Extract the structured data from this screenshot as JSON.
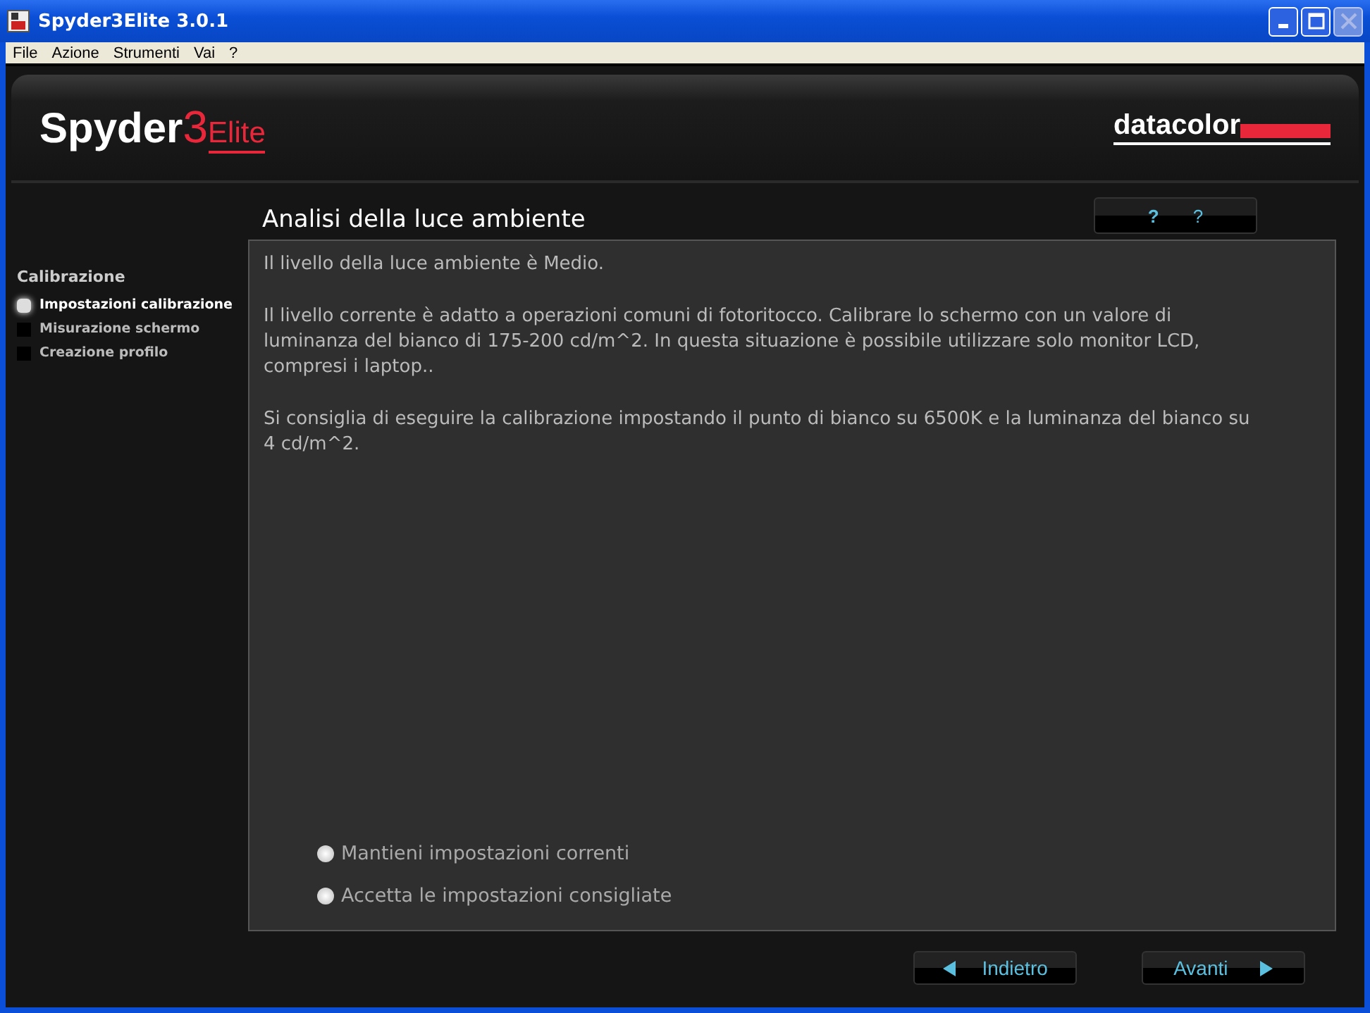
{
  "window": {
    "title": "Spyder3Elite 3.0.1"
  },
  "menu": [
    "File",
    "Azione",
    "Strumenti",
    "Vai",
    "?"
  ],
  "logo": {
    "brand": "Spyder",
    "number": "3",
    "edition": "Elite"
  },
  "vendor": "datacolor",
  "help": [
    "?",
    "?"
  ],
  "sidebar": {
    "heading": "Calibrazione",
    "steps": [
      {
        "label": "Impostazioni calibrazione",
        "selected": true
      },
      {
        "label": "Misurazione schermo",
        "selected": false
      },
      {
        "label": "Creazione profilo",
        "selected": false
      }
    ]
  },
  "page_title": "Analisi della luce ambiente",
  "paragraphs": [
    "Il livello della luce ambiente è Medio.",
    "Il livello corrente è adatto a operazioni comuni di fotoritocco. Calibrare lo schermo con un valore di luminanza del bianco di 175-200 cd/m^2. In questa situazione è possibile utilizzare solo monitor LCD, compresi i laptop..",
    "Si consiglia di eseguire la calibrazione impostando il punto di bianco su 6500K e la luminanza del bianco su 4 cd/m^2."
  ],
  "options": [
    {
      "label": "Mantieni impostazioni correnti",
      "selected": false
    },
    {
      "label": "Accetta le impostazioni consigliate",
      "selected": false
    }
  ],
  "buttons": [
    {
      "kind": "back",
      "label": "Indietro"
    },
    {
      "kind": "next",
      "label": "Avanti"
    }
  ]
}
